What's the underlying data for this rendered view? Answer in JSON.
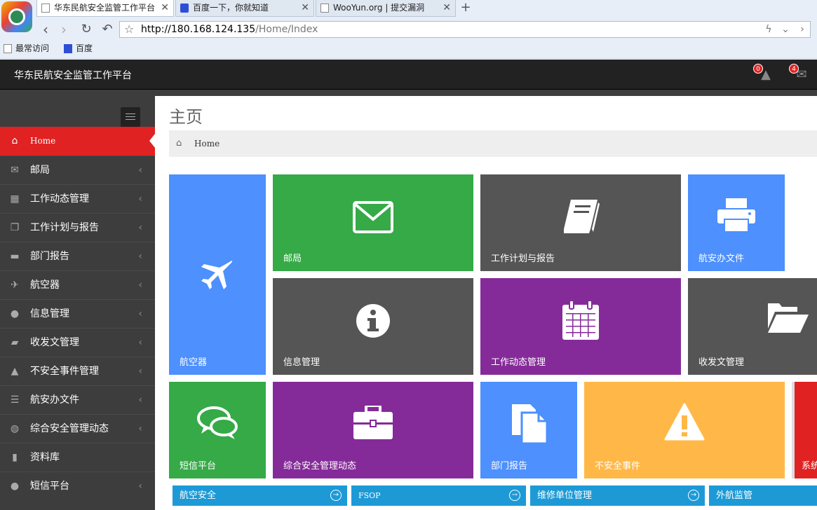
{
  "browser": {
    "tabs": [
      {
        "title": "华东民航安全监管工作平台",
        "icon": "page-icon"
      },
      {
        "title": "百度一下，你就知道",
        "icon": "baidu-icon"
      },
      {
        "title": "WooYun.org | 提交漏洞",
        "icon": "page-icon"
      }
    ],
    "url_host": "http://180.168.124.135",
    "url_path": "/Home/Index",
    "bookmarks": [
      {
        "label": "最常访问",
        "icon": "page-icon"
      },
      {
        "label": "百度",
        "icon": "baidu-icon"
      }
    ]
  },
  "header": {
    "title": "华东民航安全监管工作平台",
    "alerts_count": "0",
    "mail_count": "4"
  },
  "sidebar": {
    "items": [
      {
        "label": "Home",
        "icon": "home-icon",
        "active": true
      },
      {
        "label": "邮局",
        "icon": "envelope-icon"
      },
      {
        "label": "工作动态管理",
        "icon": "calendar-icon"
      },
      {
        "label": "工作计划与报告",
        "icon": "copy-icon"
      },
      {
        "label": "部门报告",
        "icon": "briefcase-icon"
      },
      {
        "label": "航空器",
        "icon": "plane-icon"
      },
      {
        "label": "信息管理",
        "icon": "map-marker-icon"
      },
      {
        "label": "收发文管理",
        "icon": "folder-open-icon"
      },
      {
        "label": "不安全事件管理",
        "icon": "warning-icon"
      },
      {
        "label": "航安办文件",
        "icon": "tasks-icon"
      },
      {
        "label": "综合安全管理动态",
        "icon": "globe-icon"
      },
      {
        "label": "资料库",
        "icon": "book-icon"
      },
      {
        "label": "短信平台",
        "icon": "map-marker-icon"
      }
    ]
  },
  "main": {
    "page_title": "主页",
    "breadcrumb": "Home",
    "tiles": {
      "aircraft": "航空器",
      "mail": "邮局",
      "plan_report": "工作计划与报告",
      "safety_office_docs": "航安办文件",
      "info_mgmt": "信息管理",
      "work_dynamics": "工作动态管理",
      "doc_dispatch": "收发文管理",
      "sms": "短信平台",
      "integrated_safety": "综合安全管理动态",
      "dept_report": "部门报告",
      "unsafe_event": "不安全事件",
      "system": "系统"
    },
    "sub_tiles": [
      "航空安全",
      "FSOP",
      "维修单位管理",
      "外航监管"
    ]
  }
}
